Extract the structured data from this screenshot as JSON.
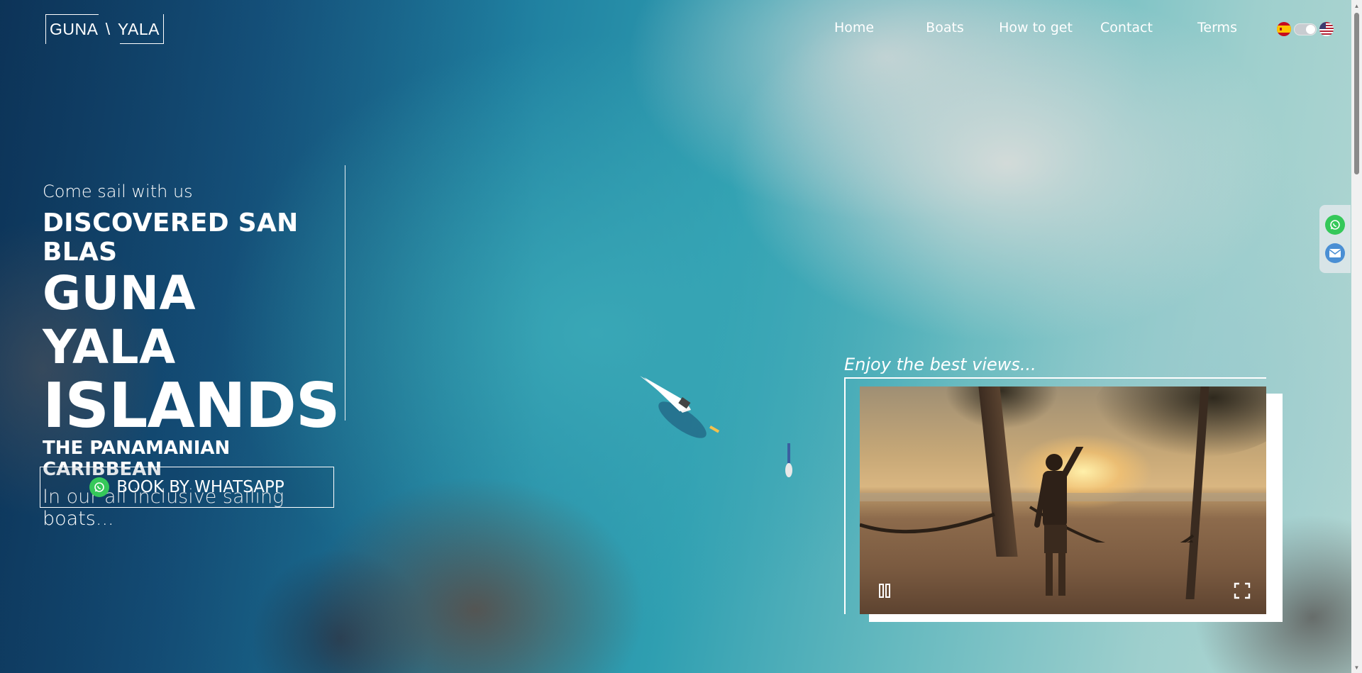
{
  "logo": {
    "left": "GUNA",
    "sep": "\\",
    "right": "YALA"
  },
  "nav": [
    {
      "label": "Home"
    },
    {
      "label": "Boats"
    },
    {
      "label": "How to get"
    },
    {
      "label": "Contact"
    },
    {
      "label": "Terms"
    }
  ],
  "language": {
    "left_flag": "spain-flag",
    "right_flag": "usa-flag",
    "toggle_state": "english"
  },
  "hero": {
    "tagline": "Come sail with us",
    "line1": "DISCOVERED SAN BLAS",
    "line2": "GUNA YALA",
    "line3": "ISLANDS",
    "line4": "THE PANAMANIAN CARIBBEAN",
    "line5": "In our all inclusive sailing boats..."
  },
  "cta": {
    "label": "BOOK BY WHATSAPP",
    "icon": "whatsapp-icon"
  },
  "video": {
    "caption": "Enjoy the best views...",
    "controls": {
      "play_state": "playing",
      "pause_icon": "pause-icon",
      "fullscreen_icon": "fullscreen-icon"
    }
  },
  "side_contact": [
    {
      "icon": "whatsapp-icon",
      "color": "#35c85a"
    },
    {
      "icon": "mail-icon",
      "color": "#4a8fd4"
    }
  ],
  "colors": {
    "accent": "#35c85a",
    "text": "#ffffff"
  }
}
